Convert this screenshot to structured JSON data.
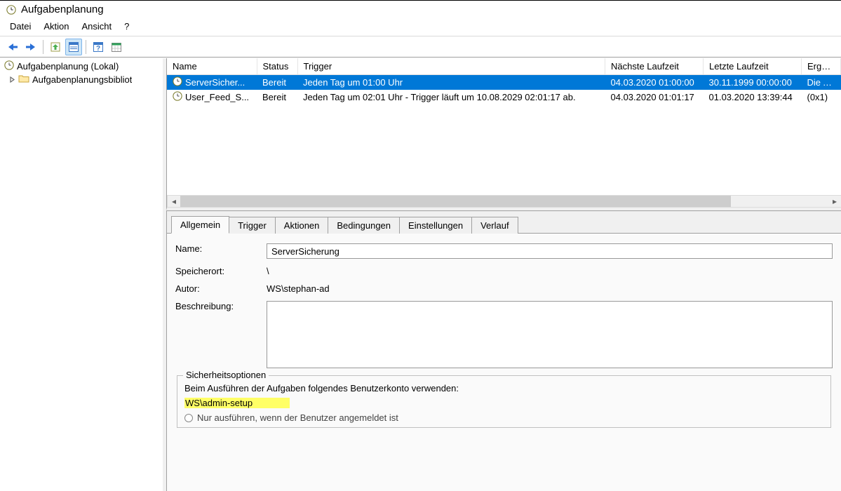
{
  "titlebar": {
    "app_name": "Aufgabenplanung"
  },
  "menu": {
    "items": [
      "Datei",
      "Aktion",
      "Ansicht",
      "?"
    ]
  },
  "toolbar": {
    "items": [
      {
        "name": "back-icon"
      },
      {
        "name": "forward-icon"
      },
      {
        "name": "up-icon"
      },
      {
        "name": "properties-icon"
      },
      {
        "name": "help-icon"
      },
      {
        "name": "calendar-icon"
      }
    ]
  },
  "tree": {
    "root": "Aufgabenplanung (Lokal)",
    "child": "Aufgabenplanungsbibliot"
  },
  "task_table": {
    "columns": [
      "Name",
      "Status",
      "Trigger",
      "Nächste Laufzeit",
      "Letzte Laufzeit",
      "Ergebn"
    ],
    "rows": [
      {
        "name": "ServerSicher...",
        "status": "Bereit",
        "trigger": "Jeden Tag um 01:00 Uhr",
        "next": "04.03.2020 01:00:00",
        "last": "30.11.1999 00:00:00",
        "result": "Die Auf",
        "selected": true
      },
      {
        "name": "User_Feed_S...",
        "status": "Bereit",
        "trigger": "Jeden Tag um 02:01 Uhr - Trigger läuft um 10.08.2029 02:01:17 ab.",
        "next": "04.03.2020 01:01:17",
        "last": "01.03.2020 13:39:44",
        "result": "(0x1)",
        "selected": false
      }
    ]
  },
  "details": {
    "tabs": [
      "Allgemein",
      "Trigger",
      "Aktionen",
      "Bedingungen",
      "Einstellungen",
      "Verlauf"
    ],
    "active_tab": 0,
    "labels": {
      "name": "Name:",
      "location": "Speicherort:",
      "author": "Autor:",
      "description": "Beschreibung:"
    },
    "name_value": "ServerSicherung",
    "location_value": "\\",
    "author_value": "WS\\stephan-ad",
    "security": {
      "group_title": "Sicherheitsoptionen",
      "account_line": "Beim Ausführen der Aufgaben folgendes Benutzerkonto verwenden:",
      "account_value": "WS\\admin-setup",
      "radio1": "Nur ausführen, wenn der Benutzer angemeldet ist"
    }
  }
}
